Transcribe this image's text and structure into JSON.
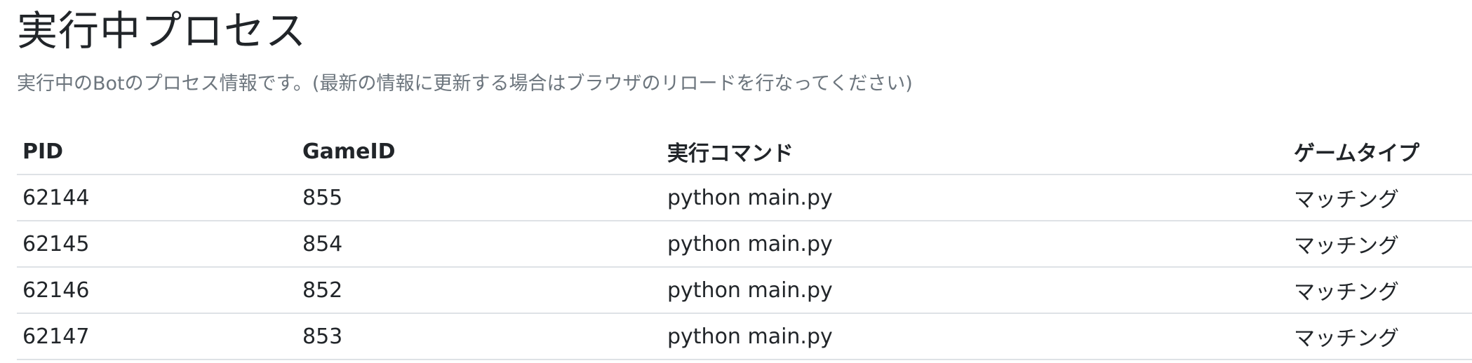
{
  "page": {
    "title": "実行中プロセス",
    "description": "実行中のBotのプロセス情報です。(最新の情報に更新する場合はブラウザのリロードを行なってください)"
  },
  "table": {
    "headers": {
      "pid": "PID",
      "game_id": "GameID",
      "command": "実行コマンド",
      "game_type": "ゲームタイプ"
    },
    "rows": [
      {
        "pid": "62144",
        "game_id": "855",
        "command": "python main.py",
        "game_type": "マッチング"
      },
      {
        "pid": "62145",
        "game_id": "854",
        "command": "python main.py",
        "game_type": "マッチング"
      },
      {
        "pid": "62146",
        "game_id": "852",
        "command": "python main.py",
        "game_type": "マッチング"
      },
      {
        "pid": "62147",
        "game_id": "853",
        "command": "python main.py",
        "game_type": "マッチング"
      }
    ]
  }
}
